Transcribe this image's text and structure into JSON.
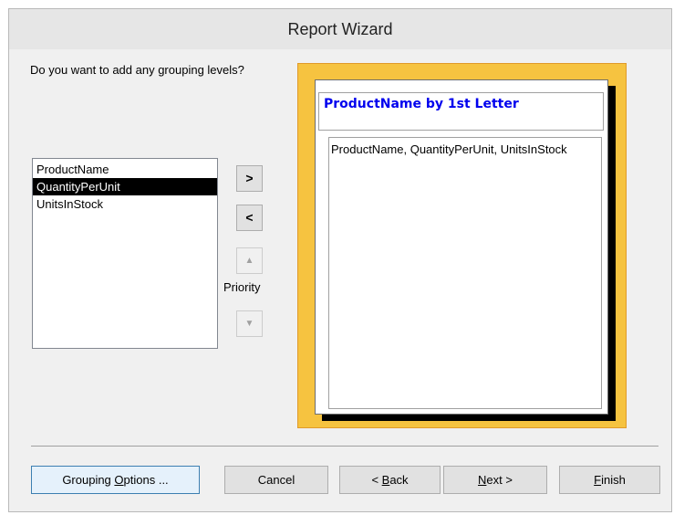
{
  "window": {
    "title": "Report Wizard"
  },
  "question": "Do you want to add any grouping levels?",
  "fields_list": {
    "items": [
      "ProductName",
      "QuantityPerUnit",
      "UnitsInStock"
    ],
    "selected_index": 1
  },
  "move_buttons": {
    "add": ">",
    "remove": "<",
    "priority_label": "Priority",
    "up_icon": "arrow-up-icon",
    "down_icon": "arrow-down-icon"
  },
  "preview": {
    "group_header": "ProductName by 1st Letter",
    "detail_text": "ProductName, QuantityPerUnit, UnitsInStock"
  },
  "buttons": {
    "grouping_options": {
      "pre": "Grouping ",
      "key": "O",
      "post": "ptions ..."
    },
    "cancel": "Cancel",
    "back": {
      "pre": "< ",
      "key": "B",
      "post": "ack"
    },
    "next": {
      "pre": "",
      "key": "N",
      "post": "ext >"
    },
    "finish": {
      "pre": "",
      "key": "F",
      "post": "inish"
    }
  },
  "colors": {
    "header_text": "#0000ee",
    "preview_frame": "#f6c340",
    "selection": "#000000"
  }
}
